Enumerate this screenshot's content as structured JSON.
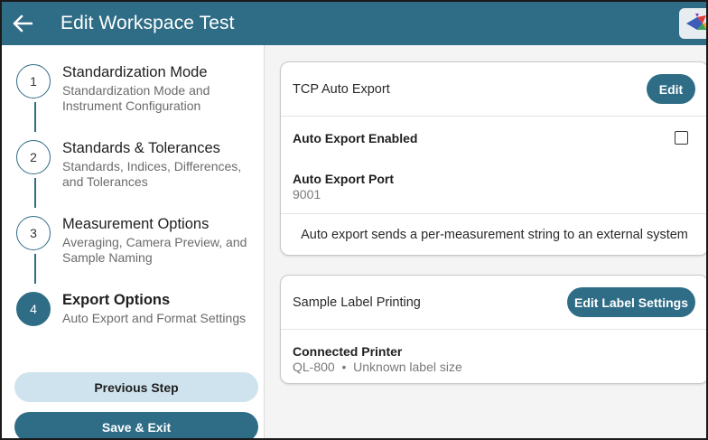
{
  "header": {
    "title": "Edit Workspace Test",
    "back_icon": "arrow-left-icon",
    "logo_icon": "app-logo-icon",
    "color": "#2f6d87"
  },
  "steps": [
    {
      "number": "1",
      "title": "Standardization Mode",
      "subtitle": "Standardization Mode and Instrument Configuration",
      "active": false
    },
    {
      "number": "2",
      "title": "Standards & Tolerances",
      "subtitle": "Standards, Indices, Differences, and Tolerances",
      "active": false
    },
    {
      "number": "3",
      "title": "Measurement Options",
      "subtitle": "Averaging, Camera Preview, and Sample Naming",
      "active": false
    },
    {
      "number": "4",
      "title": "Export Options",
      "subtitle": "Auto Export and Format Settings",
      "active": true
    }
  ],
  "buttons": {
    "previous": "Previous Step",
    "save": "Save & Exit"
  },
  "tcp_card": {
    "title": "TCP Auto Export",
    "edit_label": "Edit",
    "enabled_label": "Auto Export Enabled",
    "enabled_checked": false,
    "port_label": "Auto Export Port",
    "port_value": "9001",
    "note": "Auto export sends a per-measurement string to an external system"
  },
  "label_card": {
    "title": "Sample Label Printing",
    "edit_label": "Edit Label Settings",
    "printer_label": "Connected Printer",
    "printer_value": "QL-800  •  Unknown label size"
  },
  "colors": {
    "accent": "#2f6d87",
    "accent_light": "#cfe3ee",
    "panel_bg": "#f4f4f4"
  }
}
